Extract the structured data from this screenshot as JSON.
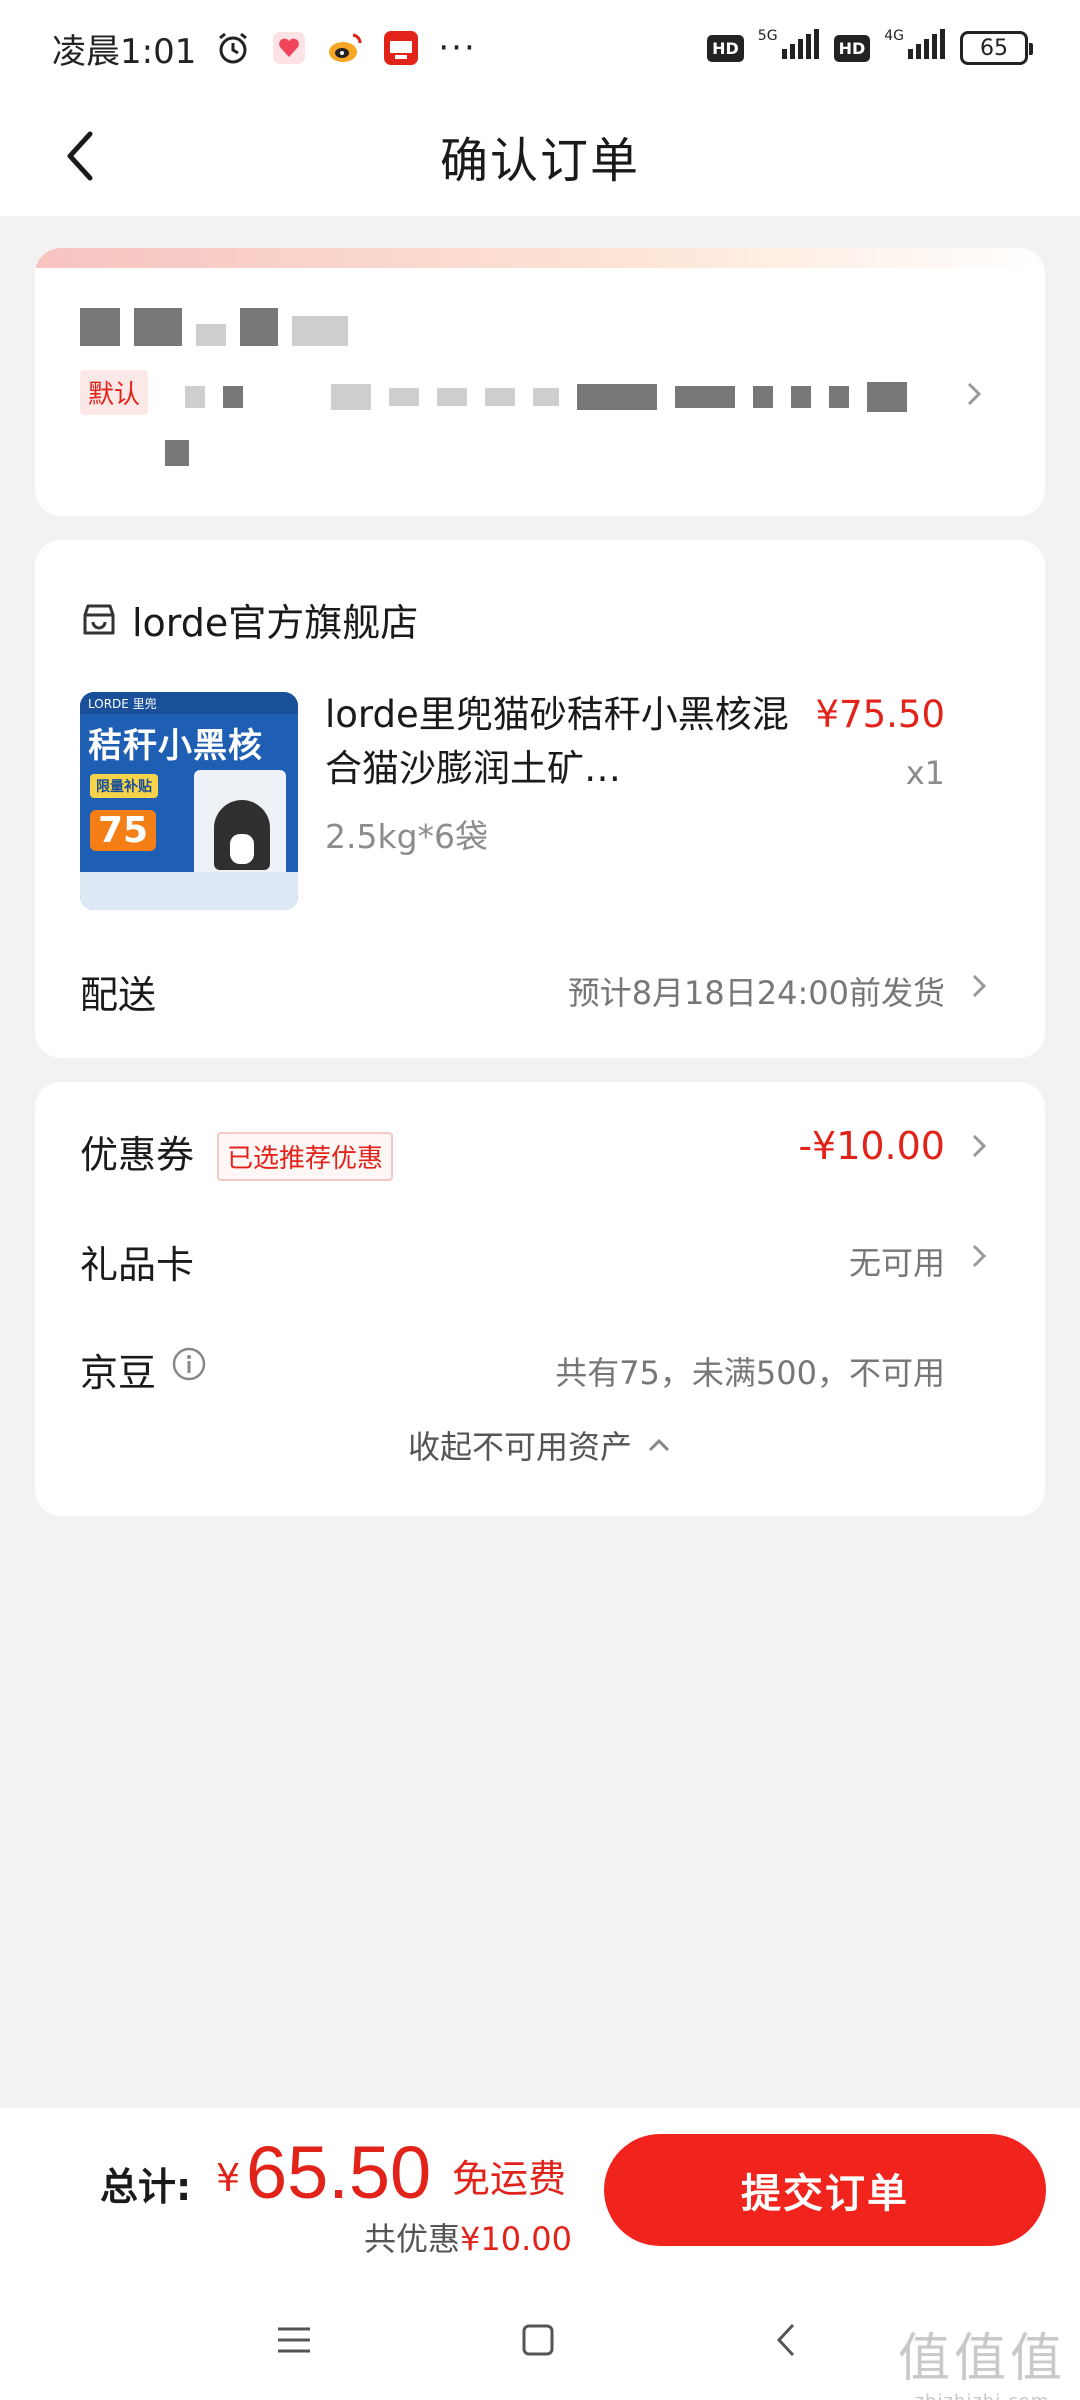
{
  "status_bar": {
    "time": "凌晨1:01",
    "more": "···",
    "hd1": "HD",
    "net1": "5G",
    "hd2": "HD",
    "net2": "4G",
    "battery": "65",
    "icons": [
      "alarm-icon",
      "health-app-icon",
      "weibo-icon",
      "app-badge-icon"
    ]
  },
  "header": {
    "title": "确认订单",
    "back_icon": "chevron-left-icon"
  },
  "address": {
    "default_tag": "默认"
  },
  "store": {
    "name": "lorde官方旗舰店",
    "icon": "store-icon",
    "product": {
      "image_brand": "LORDE 里兜",
      "image_title": "秸秆小黑核",
      "image_price": "75",
      "image_badge": "限量补贴",
      "title": "lorde里兜猫砂秸秆小黑核混合猫沙膨润土矿…",
      "spec": "2.5kg*6袋",
      "price": "¥75.50",
      "quantity": "x1"
    },
    "delivery": {
      "label": "配送",
      "value": "预计8月18日24:00前发货"
    }
  },
  "discounts": {
    "coupon": {
      "label": "优惠券",
      "tag": "已选推荐优惠",
      "value": "-¥10.00"
    },
    "gift_card": {
      "label": "礼品卡",
      "value": "无可用"
    },
    "jingdou": {
      "label": "京豆",
      "value": "共有75，未满500，不可用"
    },
    "collapse": "收起不可用资产"
  },
  "footer": {
    "total_label": "总计:",
    "currency": "¥",
    "total_amount": "65.50",
    "free_shipping": "免运费",
    "saved_prefix": "共优惠",
    "saved_amount": "¥10.00",
    "submit": "提交订单"
  },
  "watermark": {
    "glyphs": "值值值",
    "url": "zhizhizhi.com"
  },
  "colors": {
    "accent": "#e2231a",
    "submit_bg": "#f0241c",
    "page_bg": "#f2f2f2"
  }
}
